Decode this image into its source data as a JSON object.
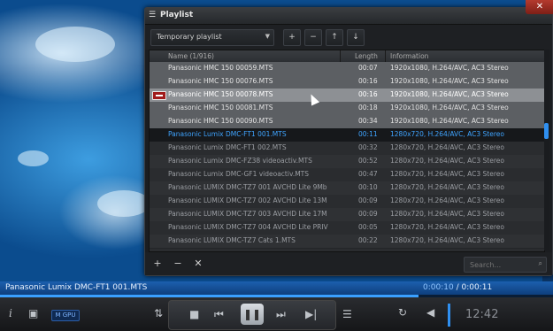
{
  "playlist": {
    "window_title": "Playlist",
    "close_label": "✕",
    "combo_value": "Temporary playlist",
    "toolbar_buttons": [
      "+",
      "−",
      "↑",
      "↓"
    ],
    "columns": {
      "name": "Name (1/916)",
      "length": "Length",
      "info": "Information"
    },
    "rows": [
      {
        "name": "Panasonic HMC 150 00059.MTS",
        "length": "00:07",
        "info": "1920x1080, H.264/AVC, AC3 Stereo"
      },
      {
        "name": "Panasonic HMC 150 00076.MTS",
        "length": "00:16",
        "info": "1920x1080, H.264/AVC, AC3 Stereo"
      },
      {
        "name": "Panasonic HMC 150 00078.MTS",
        "length": "00:16",
        "info": "1920x1080, H.264/AVC, AC3 Stereo"
      },
      {
        "name": "Panasonic HMC 150 00081.MTS",
        "length": "00:18",
        "info": "1920x1080, H.264/AVC, AC3 Stereo"
      },
      {
        "name": "Panasonic HMC 150 00090.MTS",
        "length": "00:34",
        "info": "1920x1080, H.264/AVC, AC3 Stereo"
      },
      {
        "name": "Panasonic Lumix DMC-FT1 001.MTS",
        "length": "00:11",
        "info": "1280x720, H.264/AVC, AC3 Stereo"
      },
      {
        "name": "Panasonic Lumix DMC-FT1 002.MTS",
        "length": "00:32",
        "info": "1280x720, H.264/AVC, AC3 Stereo"
      },
      {
        "name": "Panasonic Lumix DMC-FZ38 videoactiv.MTS",
        "length": "00:52",
        "info": "1280x720, H.264/AVC, AC3 Stereo"
      },
      {
        "name": "Panasonic Lumix DMC-GF1 videoactiv.MTS",
        "length": "00:47",
        "info": "1280x720, H.264/AVC, AC3 Stereo"
      },
      {
        "name": "Panasonic LUMIX DMC-TZ7 001 AVCHD Lite 9Mb",
        "length": "00:10",
        "info": "1280x720, H.264/AVC, AC3 Stereo"
      },
      {
        "name": "Panasonic LUMIX DMC-TZ7 002 AVCHD Lite 13M",
        "length": "00:09",
        "info": "1280x720, H.264/AVC, AC3 Stereo"
      },
      {
        "name": "Panasonic LUMIX DMC-TZ7 003 AVCHD Lite 17M",
        "length": "00:09",
        "info": "1280x720, H.264/AVC, AC3 Stereo"
      },
      {
        "name": "Panasonic LUMIX DMC-TZ7 004 AVCHD Lite PRIV",
        "length": "00:05",
        "info": "1280x720, H.264/AVC, AC3 Stereo"
      },
      {
        "name": "Panasonic LUMIX DMC-TZ7 Cats 1.MTS",
        "length": "00:22",
        "info": "1280x720, H.264/AVC, AC3 Stereo"
      }
    ],
    "footer_buttons": [
      "+",
      "−",
      "✕"
    ],
    "search_placeholder": "Search..."
  },
  "status": {
    "filename": "Panasonic Lumix DMC-FT1 001.MTS",
    "current_time": "0:00:10",
    "duration": "0:00:11",
    "progress": 0.91
  },
  "controls": {
    "gpu_badge": "M GPU",
    "clock": "12:42"
  },
  "colors": {
    "accent": "#3fa4ff",
    "close": "#b43a2e"
  }
}
